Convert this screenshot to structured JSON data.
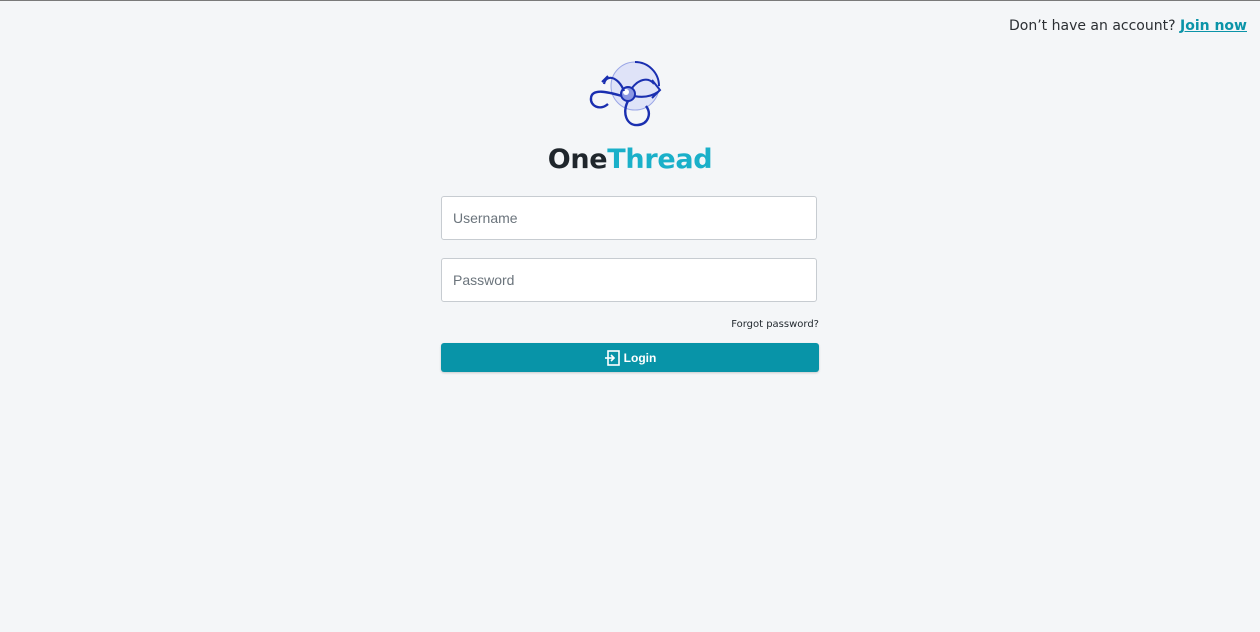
{
  "header": {
    "signup_prompt": "Don’t have an account?",
    "join_label": "Join now"
  },
  "brand": {
    "name_part1": "One",
    "name_part2": "Thread",
    "logo_icon": "spider-thread-logo-icon"
  },
  "form": {
    "username_placeholder": "Username",
    "password_placeholder": "Password",
    "forgot_label": "Forgot password?",
    "login_label": "Login",
    "login_icon": "login-arrow-icon"
  },
  "colors": {
    "background": "#f4f6f8",
    "accent": "#0894a8",
    "brand_secondary": "#1ab0c9",
    "logo_blue": "#1a2fb0"
  }
}
